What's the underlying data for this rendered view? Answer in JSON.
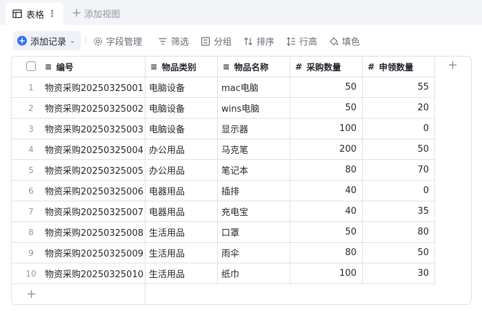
{
  "tabbar": {
    "active_tab": "表格",
    "more": "⋮",
    "add_view": "添加视图",
    "add_view_plus": "+"
  },
  "toolbar": {
    "add_record": "添加记录",
    "field_manage": "字段管理",
    "filter": "筛选",
    "group": "分组",
    "sort": "排序",
    "row_height": "行高",
    "fill": "填色"
  },
  "columns": {
    "code": "编号",
    "category": "物品类别",
    "name": "物品名称",
    "purchase_qty": "采购数量",
    "request_qty": "申领数量",
    "add_col": "+"
  },
  "rows": [
    {
      "n": "1",
      "code": "物资采购20250325001",
      "category": "电脑设备",
      "name": "mac电脑",
      "purchase": "50",
      "request": "55"
    },
    {
      "n": "2",
      "code": "物资采购20250325002",
      "category": "电脑设备",
      "name": "wins电脑",
      "purchase": "50",
      "request": "20"
    },
    {
      "n": "3",
      "code": "物资采购20250325003",
      "category": "电脑设备",
      "name": "显示器",
      "purchase": "100",
      "request": "0"
    },
    {
      "n": "4",
      "code": "物资采购20250325004",
      "category": "办公用品",
      "name": "马克笔",
      "purchase": "200",
      "request": "50"
    },
    {
      "n": "5",
      "code": "物资采购20250325005",
      "category": "办公用品",
      "name": "笔记本",
      "purchase": "80",
      "request": "70"
    },
    {
      "n": "6",
      "code": "物资采购20250325006",
      "category": "电器用品",
      "name": "插排",
      "purchase": "40",
      "request": "0"
    },
    {
      "n": "7",
      "code": "物资采购20250325007",
      "category": "电器用品",
      "name": "充电宝",
      "purchase": "40",
      "request": "35"
    },
    {
      "n": "8",
      "code": "物资采购20250325008",
      "category": "生活用品",
      "name": "口罩",
      "purchase": "50",
      "request": "80"
    },
    {
      "n": "9",
      "code": "物资采购20250325009",
      "category": "生活用品",
      "name": "雨伞",
      "purchase": "80",
      "request": "50"
    },
    {
      "n": "10",
      "code": "物资采购20250325010",
      "category": "生活用品",
      "name": "纸巾",
      "purchase": "100",
      "request": "30"
    }
  ],
  "add_row": "+",
  "colors": {
    "accent": "#3370ff",
    "border": "#dee0e3",
    "muted": "#8f959e"
  }
}
